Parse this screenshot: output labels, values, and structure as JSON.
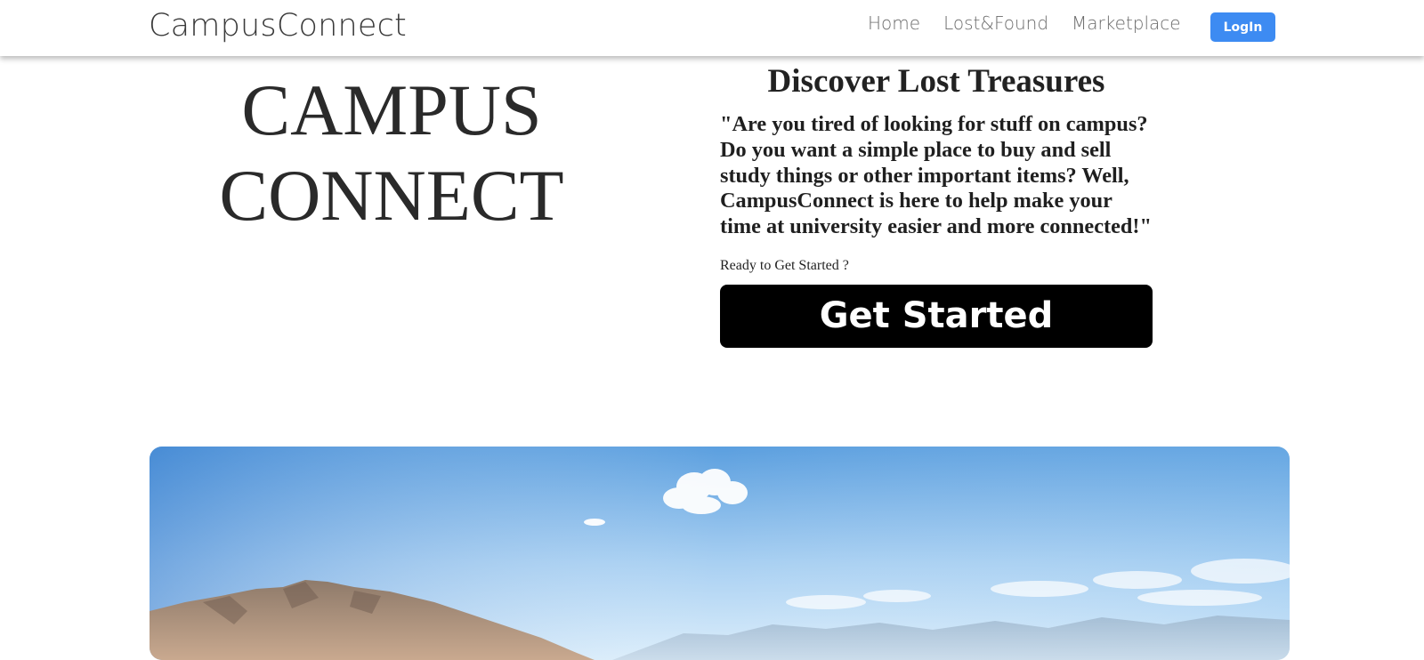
{
  "navbar": {
    "brand": "CampusConnect",
    "links": [
      "Home",
      "Lost&Found",
      "Marketplace"
    ],
    "login_label": "LogIn"
  },
  "hero": {
    "title_line1": "CAMPUS",
    "title_line2": "CONNECT"
  },
  "intro": {
    "heading": "Discover Lost Treasures",
    "quote": "\"Are you tired of looking for stuff on campus? Do you want a simple place to buy and sell study things or other important items? Well, CampusConnect is here to help make your time at university easier and more connected!\"",
    "ready_text": "Ready to Get Started ?",
    "cta_label": "Get Started"
  },
  "colors": {
    "login_bg": "#3d8bf2",
    "cta_bg": "#000000",
    "text_dark": "#2a2a2a",
    "nav_link": "#6b6b6b"
  },
  "icons": {
    "banner_image": "mountain-landscape-image"
  }
}
